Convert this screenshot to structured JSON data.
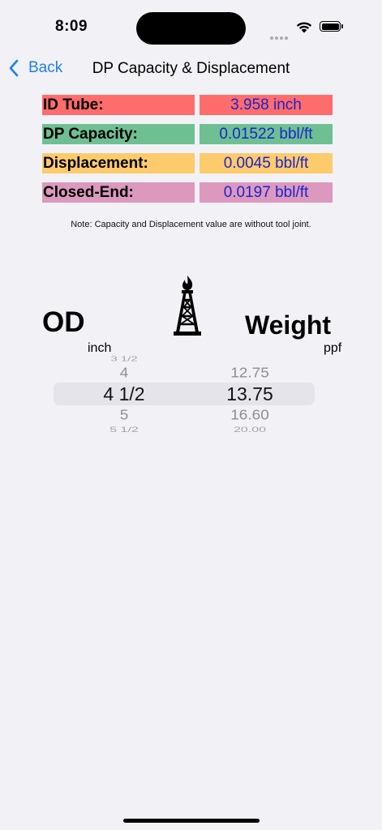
{
  "status_bar": {
    "time": "8:09"
  },
  "nav": {
    "back_label": "Back",
    "title": "DP Capacity & Displacement"
  },
  "colors": {
    "id_tube": "#fe6c6b",
    "dp_capacity": "#6ec093",
    "displacement": "#fdcb6b",
    "closed_end": "#dc98bd",
    "value_text": "#1a24cf",
    "accent": "#1f7ff2"
  },
  "results": [
    {
      "label": "ID Tube:",
      "value": "3.958 inch"
    },
    {
      "label": "DP Capacity:",
      "value": "0.01522 bbl/ft"
    },
    {
      "label": "Displacement:",
      "value": "0.0045 bbl/ft"
    },
    {
      "label": "Closed-End:",
      "value": "0.0197 bbl/ft"
    }
  ],
  "note": "Note: Capacity and Displacement value are without tool joint.",
  "od_label": "OD",
  "od_unit": "inch",
  "weight_label": "Weight",
  "weight_unit": "ppf",
  "icon": "oil-rig-icon",
  "picker": {
    "od_options": [
      "3 1/2",
      "4",
      "4 1/2",
      "5",
      "5 1/2"
    ],
    "weight_options": [
      "",
      "12.75",
      "13.75",
      "16.60",
      "20.00"
    ],
    "selected_od": "4 1/2",
    "selected_weight": "13.75"
  }
}
